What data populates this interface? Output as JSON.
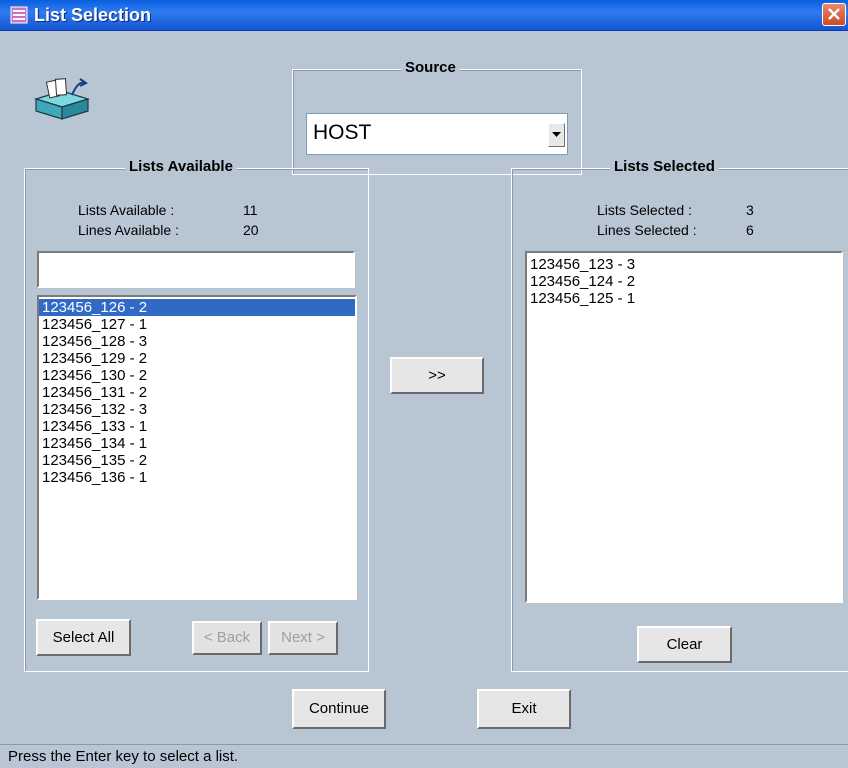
{
  "window": {
    "title": "List Selection",
    "close_icon": "close-icon",
    "app_icon": "list-window-icon"
  },
  "source": {
    "label": "Source",
    "value": "HOST"
  },
  "available": {
    "group_label": "Lists Available",
    "lists_label": "Lists Available :",
    "lists_value": "11",
    "lines_label": "Lines Available  :",
    "lines_value": "20",
    "filter_value": "",
    "items": [
      "123456_126 - 2",
      "123456_127 - 1",
      "123456_128 - 3",
      "123456_129 - 2",
      "123456_130 - 2",
      "123456_131 - 2",
      "123456_132 - 3",
      "123456_133 - 1",
      "123456_134 - 1",
      "123456_135 - 2",
      "123456_136 - 1"
    ],
    "selected_index": 0,
    "select_all_label": "Select All",
    "back_label": "< Back",
    "next_label": "Next >"
  },
  "transfer": {
    "label": ">>"
  },
  "selected": {
    "group_label": "Lists Selected",
    "lists_label": "Lists Selected :",
    "lists_value": "3",
    "lines_label": "Lines Selected  :",
    "lines_value": "6",
    "items": [
      "123456_123 - 3",
      "123456_124 - 2",
      "123456_125 - 1"
    ],
    "clear_label": "Clear"
  },
  "actions": {
    "continue_label": "Continue",
    "exit_label": "Exit"
  },
  "status": {
    "text": "Press the Enter key to select a list."
  },
  "colors": {
    "title_bar": "#0a5fe0",
    "background": "#b8c6d4",
    "selection": "#316ac5"
  }
}
